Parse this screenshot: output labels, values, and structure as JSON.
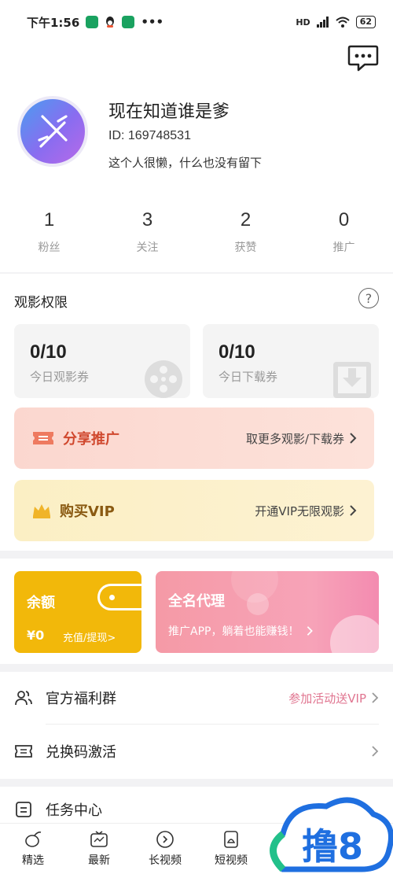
{
  "status_bar": {
    "time": "下午1:56",
    "more": "•••",
    "battery": "62",
    "network": "HD"
  },
  "profile": {
    "name": "现在知道谁是爹",
    "id": "ID: 169748531",
    "bio": "这个人很懒，什么也没有留下"
  },
  "stats": [
    {
      "value": "1",
      "label": "粉丝"
    },
    {
      "value": "3",
      "label": "关注"
    },
    {
      "value": "2",
      "label": "获赞"
    },
    {
      "value": "0",
      "label": "推广"
    }
  ],
  "viewing": {
    "title": "观影权限",
    "help": "?",
    "tickets": [
      {
        "value": "0/10",
        "label": "今日观影券"
      },
      {
        "value": "0/10",
        "label": "今日下载券"
      }
    ]
  },
  "share_banner": {
    "title": "分享推广",
    "action": "取更多观影/下载券"
  },
  "vip_banner": {
    "title": "购买VIP",
    "action": "开通VIP无限观影"
  },
  "wallet": {
    "title": "余额",
    "amount": "¥0",
    "link": "充值/提现>"
  },
  "agent": {
    "title": "全名代理",
    "subtitle": "推广APP，躺着也能赚钱！"
  },
  "list": [
    {
      "label": "官方福利群",
      "right": "参加活动送VIP"
    },
    {
      "label": "兑换码激活",
      "right": ""
    }
  ],
  "task": {
    "label": "任务中心"
  },
  "tabs": [
    {
      "label": "精选",
      "icon": "seed-icon"
    },
    {
      "label": "最新",
      "icon": "tv-icon"
    },
    {
      "label": "长视频",
      "icon": "play-circle-icon"
    },
    {
      "label": "短视频",
      "icon": "short-video-icon"
    }
  ],
  "watermark": {
    "text": "撸8"
  },
  "colors": {
    "wallet": "#f2b80a",
    "agent": "#f59aa6",
    "share_text": "#d0482e",
    "vip_text": "#8a5a12",
    "accent_pink": "#e07590"
  }
}
